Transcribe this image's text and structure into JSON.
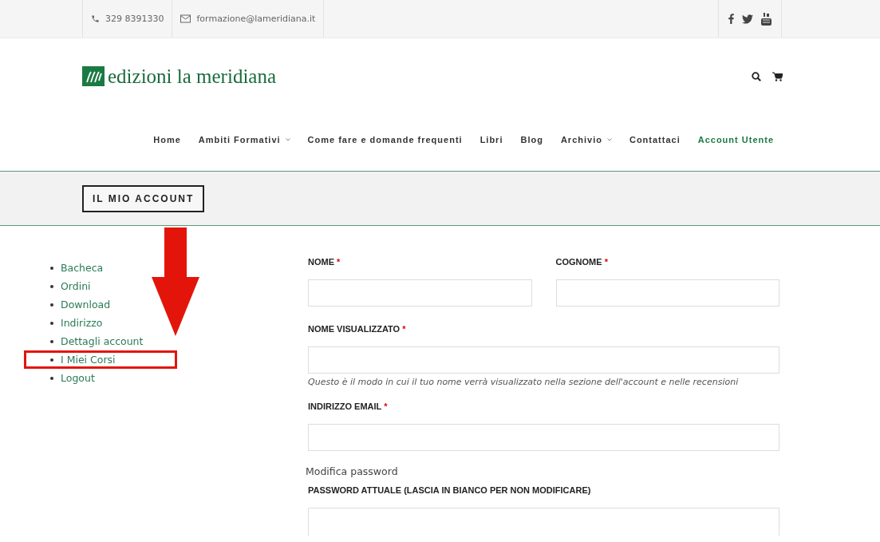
{
  "topbar": {
    "phone": "329 8391330",
    "email": "formazione@lameridiana.it"
  },
  "logo": {
    "text": "edizioni la meridiana"
  },
  "nav": [
    {
      "label": "Home",
      "dropdown": false,
      "selected": false
    },
    {
      "label": "Ambiti Formativi",
      "dropdown": true,
      "selected": false
    },
    {
      "label": "Come fare e domande frequenti",
      "dropdown": false,
      "selected": false
    },
    {
      "label": "Libri",
      "dropdown": false,
      "selected": false
    },
    {
      "label": "Blog",
      "dropdown": false,
      "selected": false
    },
    {
      "label": "Archivio",
      "dropdown": true,
      "selected": false
    },
    {
      "label": "Contattaci",
      "dropdown": false,
      "selected": false
    },
    {
      "label": "Account Utente",
      "dropdown": false,
      "selected": true
    }
  ],
  "page_title": "IL MIO ACCOUNT",
  "account_menu": [
    {
      "label": "Bacheca",
      "highlighted": false
    },
    {
      "label": "Ordini",
      "highlighted": false
    },
    {
      "label": "Download",
      "highlighted": false
    },
    {
      "label": "Indirizzo",
      "highlighted": false
    },
    {
      "label": "Dettagli account",
      "highlighted": false
    },
    {
      "label": "I Miei Corsi",
      "highlighted": true
    },
    {
      "label": "Logout",
      "highlighted": false
    }
  ],
  "form": {
    "name_row": [
      {
        "label": "NOME",
        "mark": "*"
      },
      {
        "label": "COGNOME",
        "mark": "*"
      }
    ],
    "display_name": {
      "label": "NOME VISUALIZZATO",
      "mark": "*",
      "hint": "Questo è il modo in cui il tuo nome verrà visualizzato nella sezione dell'account e nelle recensioni"
    },
    "email": {
      "label": "INDIRIZZO EMAIL",
      "mark": "*"
    },
    "password_legend": "Modifica password",
    "current_password": {
      "label": "PASSWORD ATTUALE (LASCIA IN BIANCO PER NON MODIFICARE)"
    }
  }
}
